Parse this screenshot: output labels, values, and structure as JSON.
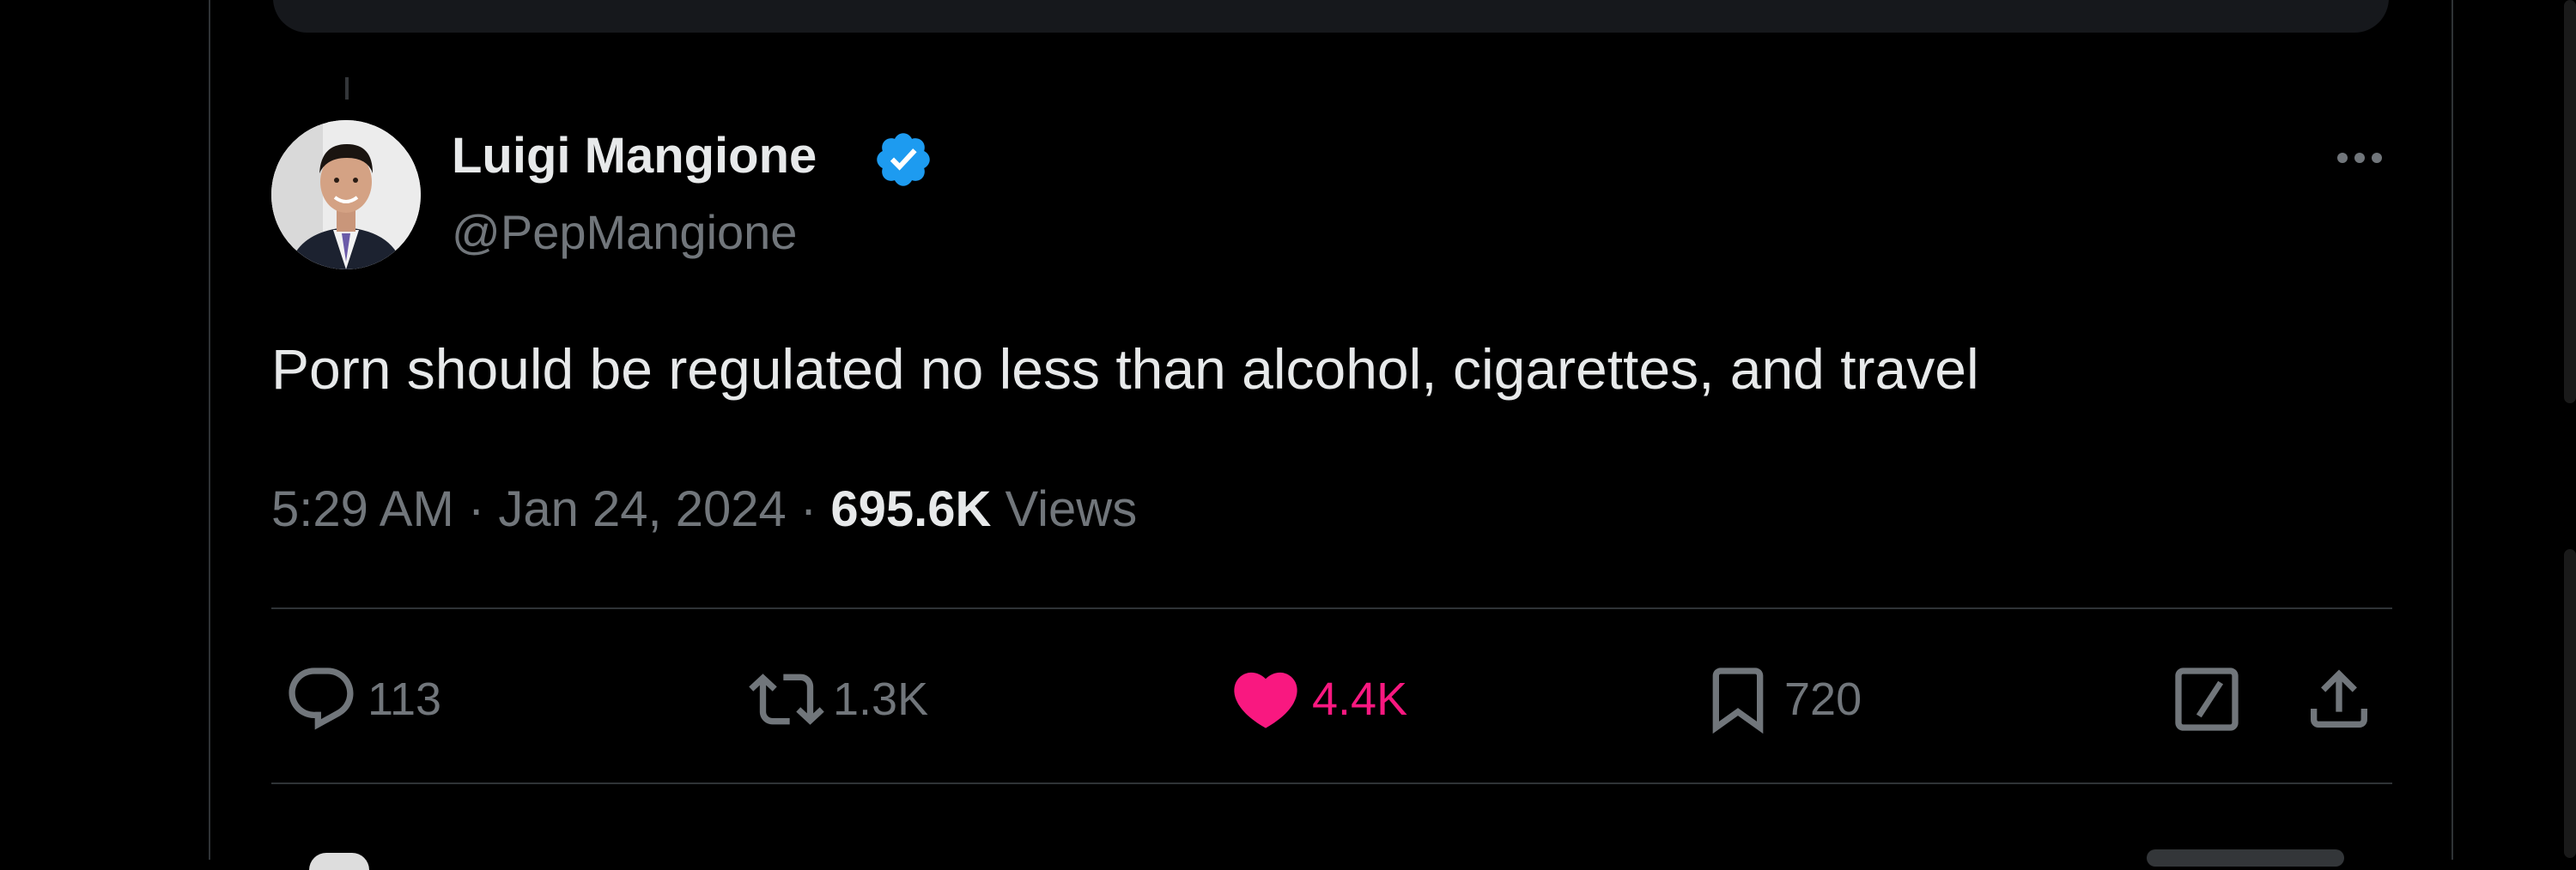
{
  "tweet": {
    "author": {
      "display_name": "Luigi Mangione",
      "handle": "@PepMangione",
      "verified": true,
      "verified_color": "#1d9bf0"
    },
    "text": "Porn should be regulated no less than alcohol, cigarettes, and travel",
    "time": "5:29 AM",
    "separator": "·",
    "date": "Jan 24, 2024",
    "views_count": "695.6K",
    "views_label": "Views"
  },
  "actions": {
    "reply_count": "113",
    "retweet_count": "1.3K",
    "like_count": "4.4K",
    "bookmark_count": "720",
    "liked": true,
    "like_color": "#f91880"
  },
  "icons": [
    "verified-badge-icon",
    "more-icon",
    "reply-icon",
    "retweet-icon",
    "heart-icon",
    "bookmark-icon",
    "grok-icon",
    "share-icon"
  ]
}
